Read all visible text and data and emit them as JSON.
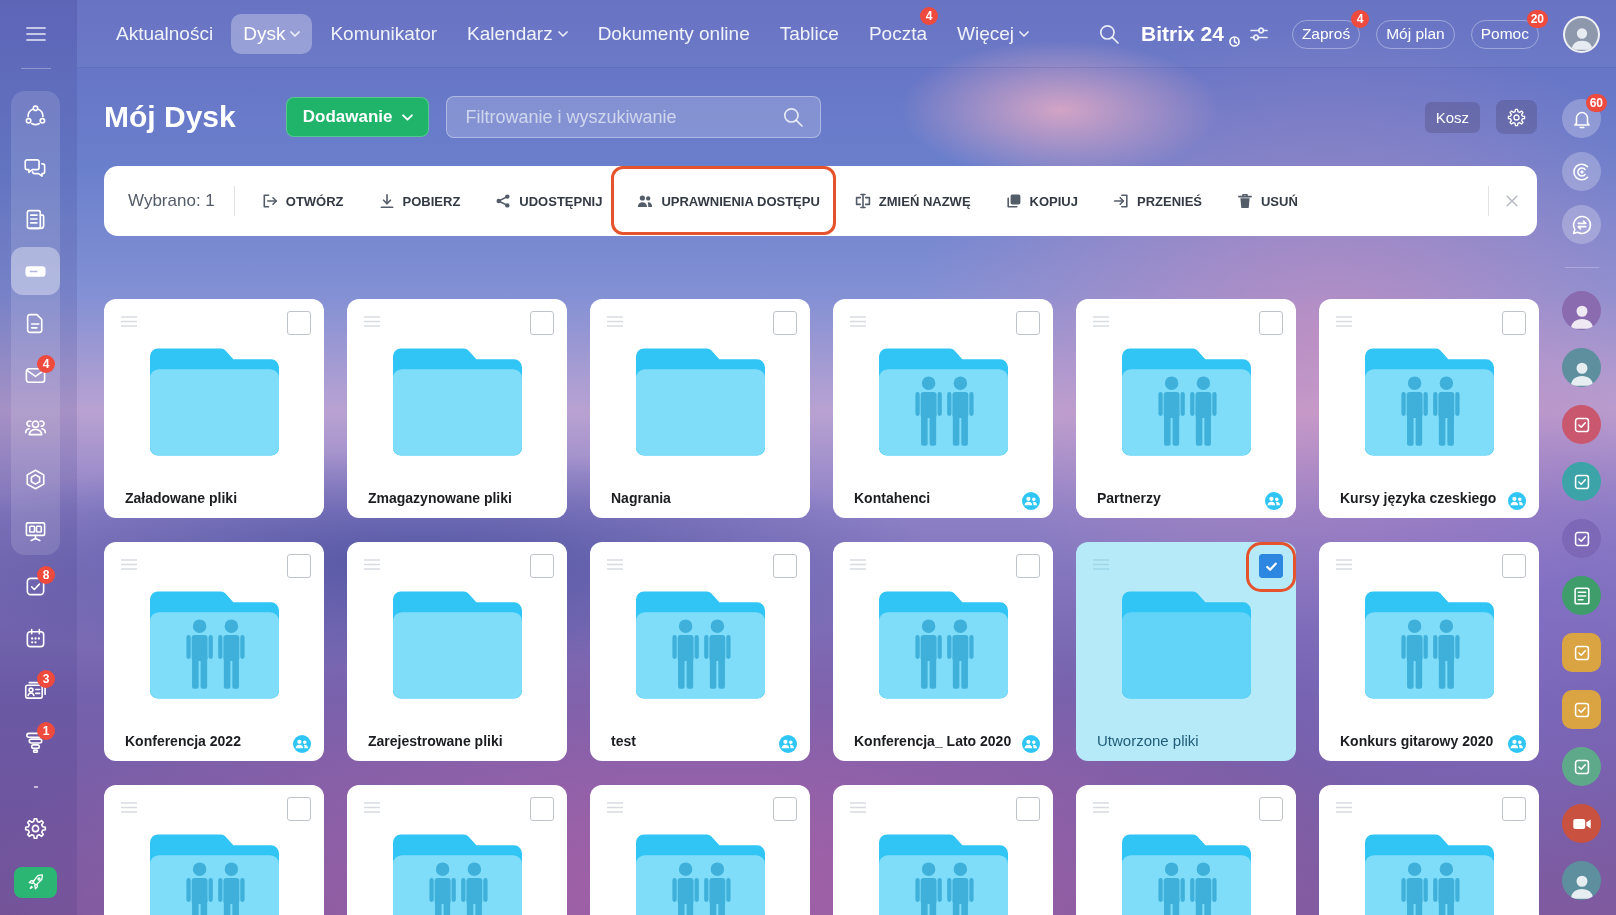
{
  "top_bar": {
    "nav": [
      {
        "label": "Aktualności",
        "selected": false,
        "dropdown": false
      },
      {
        "label": "Dysk",
        "selected": true,
        "dropdown": true
      },
      {
        "label": "Komunikator",
        "selected": false,
        "dropdown": false
      },
      {
        "label": "Kalendarz",
        "selected": false,
        "dropdown": true
      },
      {
        "label": "Dokumenty online",
        "selected": false,
        "dropdown": false
      },
      {
        "label": "Tablice",
        "selected": false,
        "dropdown": false
      },
      {
        "label": "Poczta",
        "selected": false,
        "dropdown": false,
        "badge": "4"
      },
      {
        "label": "Więcej",
        "selected": false,
        "dropdown": true
      }
    ],
    "logo": "Bitrix 24",
    "buttons": [
      {
        "label": "Zaproś",
        "badge": "4"
      },
      {
        "label": "Mój plan"
      },
      {
        "label": "Pomoc",
        "badge": "20"
      }
    ]
  },
  "left_sidebar": {
    "pinned": [
      {
        "kind": "nodes",
        "selected": false
      },
      {
        "kind": "chat",
        "selected": false
      },
      {
        "kind": "newspaper",
        "selected": false
      },
      {
        "kind": "drive",
        "selected": true
      },
      {
        "kind": "document",
        "selected": false
      },
      {
        "kind": "envelope",
        "selected": false,
        "badge": "4"
      },
      {
        "kind": "people",
        "selected": false
      },
      {
        "kind": "hexagon",
        "selected": false
      },
      {
        "kind": "presentation",
        "selected": false
      }
    ],
    "more": [
      {
        "kind": "task",
        "selected": false,
        "badge": "8"
      },
      {
        "kind": "calendar",
        "selected": false
      },
      {
        "kind": "contact",
        "selected": false,
        "badge": "3"
      },
      {
        "kind": "funnel",
        "selected": false,
        "badge": "1"
      }
    ],
    "bottom": [
      {
        "kind": "gear"
      },
      {
        "kind": "rocket"
      }
    ]
  },
  "page_header": {
    "title": "Mój Dysk",
    "add_button": "Dodawanie",
    "search": {
      "placeholder": "Filtrowanie i wyszukiwanie"
    },
    "trash_button": "Kosz"
  },
  "toolbar": {
    "selection": "Wybrano: 1",
    "actions": [
      {
        "label": "OTWÓRZ",
        "kind": "open",
        "highlighted": false
      },
      {
        "label": "POBIERZ",
        "kind": "download",
        "highlighted": false
      },
      {
        "label": "UDOSTĘPNIJ",
        "kind": "share",
        "highlighted": false
      },
      {
        "label": "UPRAWNIENIA DOSTĘPU",
        "kind": "access",
        "highlighted": true
      },
      {
        "label": "ZMIEŃ NAZWĘ",
        "kind": "rename",
        "highlighted": false
      },
      {
        "label": "KOPIUJ",
        "kind": "copy",
        "highlighted": false
      },
      {
        "label": "PRZENIEŚ",
        "kind": "move",
        "highlighted": false
      },
      {
        "label": "USUŃ",
        "kind": "delete",
        "highlighted": false
      }
    ]
  },
  "folders": [
    {
      "name": "Załadowane pliki",
      "shared": false,
      "selected": false,
      "checkbox_highlighted": false
    },
    {
      "name": "Zmagazynowane pliki",
      "shared": false,
      "selected": false,
      "checkbox_highlighted": false
    },
    {
      "name": "Nagrania",
      "shared": false,
      "selected": false,
      "checkbox_highlighted": false
    },
    {
      "name": "Kontahenci",
      "shared": true,
      "selected": false,
      "checkbox_highlighted": false
    },
    {
      "name": "Partnerzy",
      "shared": true,
      "selected": false,
      "checkbox_highlighted": false
    },
    {
      "name": "Kursy języka czeskiego",
      "shared": true,
      "selected": false,
      "checkbox_highlighted": false
    },
    {
      "name": "Konferencja 2022",
      "shared": true,
      "selected": false,
      "checkbox_highlighted": false
    },
    {
      "name": "Zarejestrowane pliki",
      "shared": false,
      "selected": false,
      "checkbox_highlighted": false
    },
    {
      "name": "test",
      "shared": true,
      "selected": false,
      "checkbox_highlighted": false
    },
    {
      "name": "Konferencja_ Lato 2020",
      "shared": true,
      "selected": false,
      "checkbox_highlighted": false
    },
    {
      "name": "Utworzone pliki",
      "shared": false,
      "selected": true,
      "checkbox_highlighted": true
    },
    {
      "name": "Konkurs gitarowy 2020",
      "shared": true,
      "selected": false,
      "checkbox_highlighted": false
    },
    {
      "shared": true,
      "selected": false,
      "checkbox_highlighted": false
    },
    {
      "shared": true,
      "selected": false,
      "checkbox_highlighted": false
    },
    {
      "shared": true,
      "selected": false,
      "checkbox_highlighted": false
    },
    {
      "shared": true,
      "selected": false,
      "checkbox_highlighted": false
    },
    {
      "shared": true,
      "selected": false,
      "checkbox_highlighted": false
    },
    {
      "shared": true,
      "selected": false,
      "checkbox_highlighted": false
    }
  ],
  "right_sidebar": {
    "tools": [
      {
        "kind": "bell",
        "badge": "60"
      },
      {
        "kind": "spiral"
      },
      {
        "kind": "swap"
      }
    ],
    "chats": [
      {
        "kind": "avatar"
      },
      {
        "kind": "avatar"
      },
      {
        "kind": "task",
        "color": "#c9586f"
      },
      {
        "kind": "task",
        "color": "#3ca3a8"
      },
      {
        "kind": "task",
        "color": "#7c68b6"
      },
      {
        "kind": "news",
        "color": "#3f9d6c"
      },
      {
        "kind": "project",
        "color": "#d9a441"
      },
      {
        "kind": "project",
        "color": "#d9a441"
      },
      {
        "kind": "task",
        "color": "#5ea98a"
      },
      {
        "kind": "video",
        "color": "#c8523f"
      },
      {
        "kind": "avatar"
      }
    ]
  }
}
